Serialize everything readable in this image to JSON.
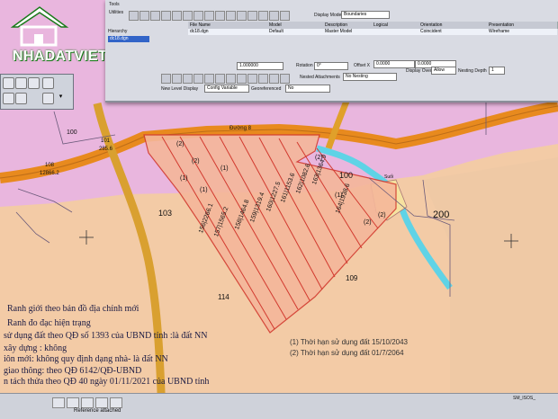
{
  "watermark": {
    "text": "NHADATVIET247.NET"
  },
  "window": {
    "menu": [
      "Tools",
      "Utilities",
      "Window"
    ],
    "display_mode_label": "Display Mode",
    "display_mode_value": "Boundaries",
    "columns": [
      "File Name",
      "Model",
      "Description",
      "Logical",
      "Orientation",
      "Presentation"
    ],
    "row": [
      "dc18.dgn",
      "Default",
      "Master Model",
      "",
      "Coincident",
      "Wireframe"
    ],
    "hierarchy_label": "Hierarchy",
    "hierarchy_item": "dc18.dgn",
    "scale_value": "1.000000",
    "rotation_label": "Rotation",
    "rotation_value": "0°",
    "offset_label": "Offset X",
    "offset_x": "0.0000",
    "offset_y": "0.0000",
    "nested_label": "Nested Attachments",
    "nested_value": "No Nesting",
    "nesting_depth_label": "Nesting Depth",
    "nesting_depth_value": "1",
    "display_overrides_label": "Display Overrides",
    "display_overrides_value": "Allow",
    "new_level_label": "New Level Display",
    "new_level_value": "Config Variable",
    "georeferenced_label": "Georeferenced",
    "georeferenced_value": "No"
  },
  "map": {
    "road_name": "Đường 8",
    "big_parcels": [
      "100",
      "101",
      "108",
      "103",
      "114",
      "109",
      "200",
      "100"
    ],
    "parcel_101_area": "285.6",
    "parcel_108_area": "12866.2",
    "strip_labels": [
      "156|2266.1",
      "157|1565.2",
      "158|1464.8",
      "159|1319.4",
      "160|1227.5",
      "161|1153.6",
      "162|1082.6",
      "163|1364.9",
      "164|1938.6"
    ],
    "marks": [
      "(2)",
      "(2)",
      "(2)",
      "(1)",
      "(1)",
      "(1)",
      "(1)",
      "(2)",
      "(2)"
    ],
    "stream_label": "Suối"
  },
  "legend": [
    "Ranh giới theo bản đồ địa chính mới",
    "Ranh đo đạc hiện trạng",
    "sử dụng đất theo QĐ số 1393 của UBND tỉnh :là đất NN",
    "xây dựng : không",
    "iôn mới: không quy định dạng nhà- là đất NN",
    "giao thông: theo QĐ 6142/QĐ-UBND",
    "n tách thửa theo QĐ 40 ngày 01/11/2021 của UBND tỉnh"
  ],
  "notes": [
    "(1) Thời hạn sử dụng đất 15/10/2043",
    "(2) Thời hạn sử dụng đất 01/7/2064"
  ],
  "status": {
    "left_text": "Reference attached",
    "right_text": "SM_ISOS_"
  },
  "colors": {
    "parcel_pink": "#e9b6de",
    "land_orange": "#f3cba6",
    "road": "#e88a1e",
    "water": "#5fd3e6",
    "boundary": "#d23a2f"
  }
}
